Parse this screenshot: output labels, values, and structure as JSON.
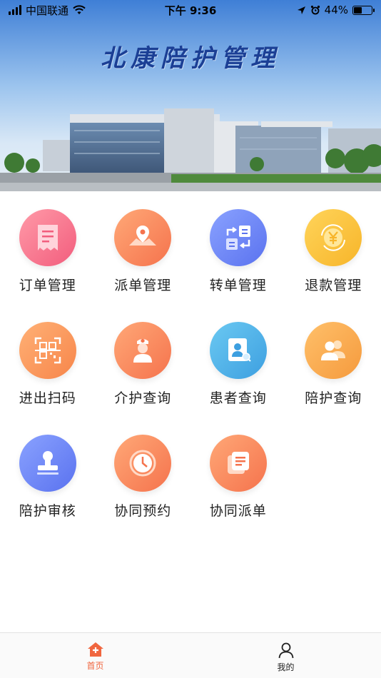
{
  "status_bar": {
    "carrier": "中国联通",
    "time": "下午 9:36",
    "battery": "44%",
    "battery_level": 0.44
  },
  "banner": {
    "title": "北康陪护管理"
  },
  "menu": [
    {
      "label": "订单管理",
      "icon": "receipt-icon",
      "color": "#f25d7d"
    },
    {
      "label": "派单管理",
      "icon": "map-pin-icon",
      "color": "#f5734d"
    },
    {
      "label": "转单管理",
      "icon": "transfer-icon",
      "color": "#5a72ef"
    },
    {
      "label": "退款管理",
      "icon": "yuan-refund-icon",
      "color": "#f7b52a"
    },
    {
      "label": "进出扫码",
      "icon": "qr-scan-icon",
      "color": "#f7854a"
    },
    {
      "label": "介护查询",
      "icon": "nurse-icon",
      "color": "#f5734d"
    },
    {
      "label": "患者查询",
      "icon": "patient-card-icon",
      "color": "#3d9fe0"
    },
    {
      "label": "陪护查询",
      "icon": "people-icon",
      "color": "#f59a3d"
    },
    {
      "label": "陪护审核",
      "icon": "stamp-icon",
      "color": "#5a72ef"
    },
    {
      "label": "协同预约",
      "icon": "clock-icon",
      "color": "#f5734d"
    },
    {
      "label": "协同派单",
      "icon": "document-stack-icon",
      "color": "#f5734d"
    }
  ],
  "tabbar": {
    "home_label": "首页",
    "mine_label": "我的",
    "accent_color": "#f0663f"
  }
}
